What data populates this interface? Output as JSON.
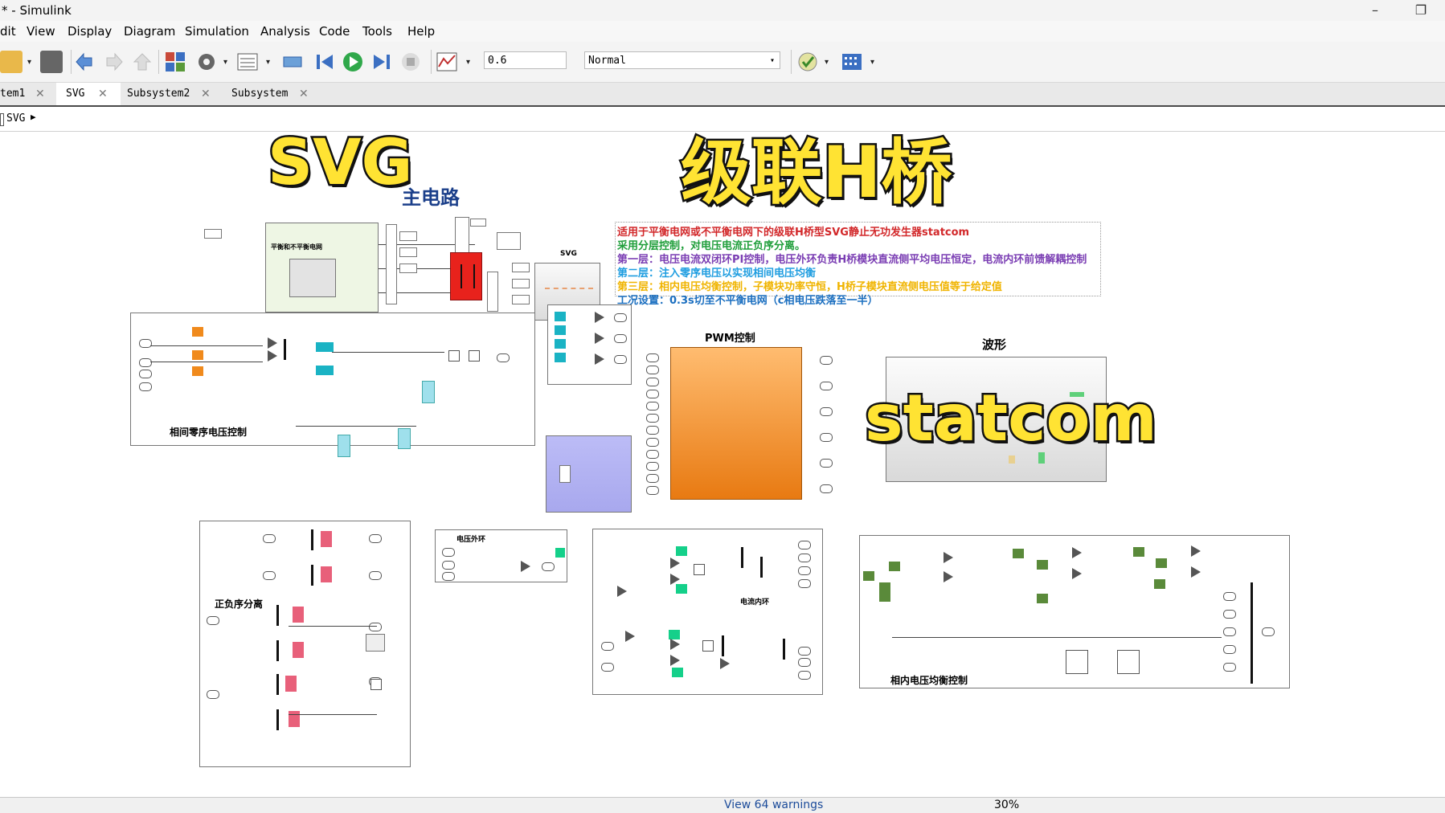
{
  "window": {
    "title": "* - Simulink",
    "minimize_label": "–",
    "restore_label": "❐"
  },
  "menu": [
    "dit",
    "View",
    "Display",
    "Diagram",
    "Simulation",
    "Analysis",
    "Code",
    "Tools",
    "Help"
  ],
  "toolbar": {
    "stop_time": "0.6",
    "sim_mode": "Normal",
    "dropdown_glyph": "▾"
  },
  "tabs": [
    {
      "label": "tem1",
      "close": "✕"
    },
    {
      "label": "SVG",
      "close": "✕"
    },
    {
      "label": "Subsystem2",
      "close": "✕"
    },
    {
      "label": "Subsystem",
      "close": "✕"
    }
  ],
  "breadcrumb": {
    "label": "SVG",
    "arrow": "▶"
  },
  "canvas": {
    "main_circuit_title": "主电路",
    "source_block_label": "平衡和不平衡电网",
    "svg_block_label": "SVG",
    "pwm_label": "PWM控制",
    "waveform_label": "波形",
    "zero_seq_label": "相间零序电压控制",
    "posneg_label": "正负序分离",
    "outer_loop_label": "电压外环",
    "inner_loop_label": "电流内环",
    "phase_balance_label": "相内电压均衡控制",
    "info_lines": [
      {
        "text": "适用于平衡电网或不平衡电网下的级联H桥型SVG静止无功发生器statcom",
        "color": "#d2282a"
      },
      {
        "text": "采用分层控制，对电压电流正负序分离。",
        "color": "#1f9e3a"
      },
      {
        "text": "第一层：电压电流双闭环PI控制，电压外环负责H桥模块直流侧平均电压恒定，电流内环前馈解耦控制",
        "color": "#7a3db3"
      },
      {
        "text": "第二层：注入零序电压以实现相间电压均衡",
        "color": "#1e9de0"
      },
      {
        "text": "第三层：相内电压均衡控制，子模块功率守恒，H桥子模块直流侧电压值等于给定值",
        "color": "#f0b400"
      },
      {
        "text": "工况设置：0.3s切至不平衡电网（c相电压跌落至一半）",
        "color": "#1b6fc0"
      }
    ]
  },
  "overlays": {
    "svg": "SVG",
    "cascade": "级联H桥",
    "statcom": "statcom"
  },
  "status": {
    "warnings": "View 64 warnings",
    "zoom": "30%"
  },
  "colors": {
    "orange": "#f08a1c",
    "teal": "#1ab3c4",
    "pink": "#e8607a",
    "green": "#15d08a",
    "olive": "#5a8a3a",
    "red": "#e8221c",
    "pwm_top": "#ffbc70",
    "pwm_bottom": "#e87a12"
  }
}
